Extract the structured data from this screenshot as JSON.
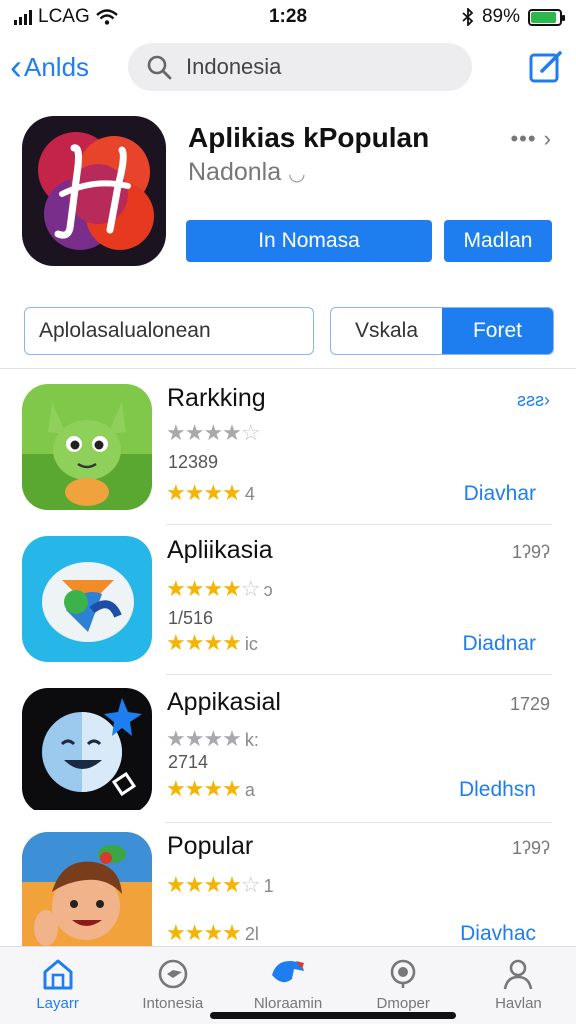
{
  "status_bar": {
    "carrier": "LCAG",
    "time": "1:28",
    "battery": "89%",
    "battery_level": 0.89
  },
  "nav": {
    "back_label": "Anlds",
    "search_value": "Indonesia"
  },
  "featured": {
    "title": "Aplikias kPopulan",
    "subtitle": "Nadonla",
    "more": "•••",
    "button_primary": "In Nomasa",
    "button_secondary": "Madlan"
  },
  "segment": {
    "field_text": "Aplolasalualonean",
    "options": [
      "Vskala",
      "Foret"
    ],
    "active_index": 1
  },
  "list": [
    {
      "name": "Rarkking",
      "meta": "ƨƨƨ",
      "stars_top_tail": "",
      "count": "12389",
      "stars_bottom_tail": "4",
      "action": "Diavhar"
    },
    {
      "name": "Apliikasia",
      "meta": "1ʔ9ʔ",
      "stars_top_tail": "ɔ",
      "count": "1/516",
      "stars_bottom_tail": "ic",
      "action": "Diadnar"
    },
    {
      "name": "Appikasial",
      "meta": "1729",
      "stars_top_tail": "k:",
      "count": "2714",
      "stars_bottom_tail": "a",
      "action": "Dledhsn"
    },
    {
      "name": "Popular",
      "meta": "1ʔ9ʔ",
      "stars_top_tail": "1",
      "count": "",
      "stars_bottom_tail": "2l",
      "action": "Diavhac"
    }
  ],
  "tabs": [
    {
      "label": "Layarr",
      "icon": "home-icon"
    },
    {
      "label": "Intonesia",
      "icon": "compass-icon"
    },
    {
      "label": "Nloraamin",
      "icon": "map-icon"
    },
    {
      "label": "Dmoper",
      "icon": "search-icon"
    },
    {
      "label": "Havlan",
      "icon": "person-icon"
    }
  ],
  "colors": {
    "accent": "#1e7ef0",
    "star": "#f5b400",
    "battery": "#2db84c"
  }
}
